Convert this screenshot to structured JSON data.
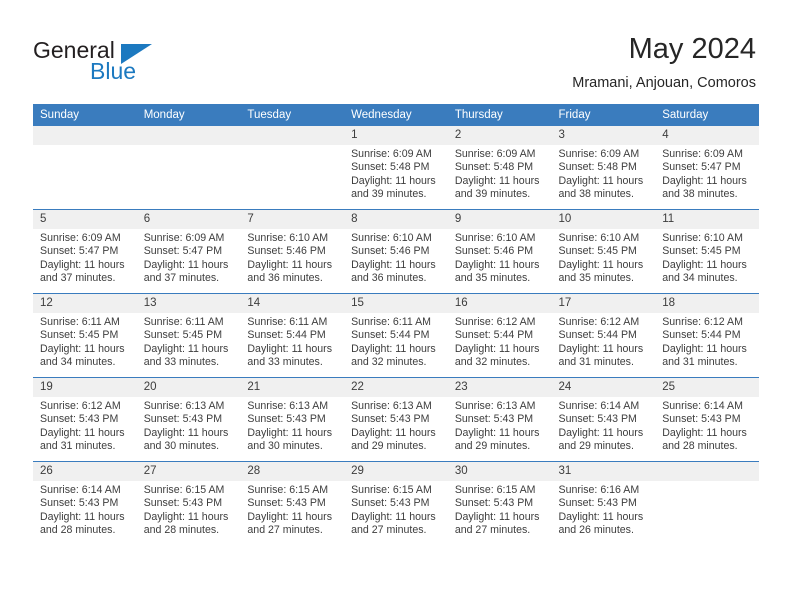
{
  "brand": {
    "name_line1": "General",
    "name_line2": "Blue",
    "logo_icon": "triangle-flag-icon",
    "color_primary": "#1c79c0",
    "color_text": "#231f20"
  },
  "header": {
    "title": "May 2024",
    "subtitle": "Mramani, Anjouan, Comoros"
  },
  "theme": {
    "header_row_bg": "#3a7cbe",
    "daynum_bg": "#f0f0f0",
    "text": "#3d3d3d",
    "divider": "#3a7cbe"
  },
  "calendar": {
    "weekday_headers": [
      "Sunday",
      "Monday",
      "Tuesday",
      "Wednesday",
      "Thursday",
      "Friday",
      "Saturday"
    ],
    "weeks": [
      [
        {
          "day": "",
          "empty": true,
          "sunrise": "",
          "sunset": "",
          "daylight_line1": "",
          "daylight_line2": ""
        },
        {
          "day": "",
          "empty": true,
          "sunrise": "",
          "sunset": "",
          "daylight_line1": "",
          "daylight_line2": ""
        },
        {
          "day": "",
          "empty": true,
          "sunrise": "",
          "sunset": "",
          "daylight_line1": "",
          "daylight_line2": ""
        },
        {
          "day": "1",
          "empty": false,
          "sunrise": "Sunrise: 6:09 AM",
          "sunset": "Sunset: 5:48 PM",
          "daylight_line1": "Daylight: 11 hours",
          "daylight_line2": "and 39 minutes."
        },
        {
          "day": "2",
          "empty": false,
          "sunrise": "Sunrise: 6:09 AM",
          "sunset": "Sunset: 5:48 PM",
          "daylight_line1": "Daylight: 11 hours",
          "daylight_line2": "and 39 minutes."
        },
        {
          "day": "3",
          "empty": false,
          "sunrise": "Sunrise: 6:09 AM",
          "sunset": "Sunset: 5:48 PM",
          "daylight_line1": "Daylight: 11 hours",
          "daylight_line2": "and 38 minutes."
        },
        {
          "day": "4",
          "empty": false,
          "sunrise": "Sunrise: 6:09 AM",
          "sunset": "Sunset: 5:47 PM",
          "daylight_line1": "Daylight: 11 hours",
          "daylight_line2": "and 38 minutes."
        }
      ],
      [
        {
          "day": "5",
          "empty": false,
          "sunrise": "Sunrise: 6:09 AM",
          "sunset": "Sunset: 5:47 PM",
          "daylight_line1": "Daylight: 11 hours",
          "daylight_line2": "and 37 minutes."
        },
        {
          "day": "6",
          "empty": false,
          "sunrise": "Sunrise: 6:09 AM",
          "sunset": "Sunset: 5:47 PM",
          "daylight_line1": "Daylight: 11 hours",
          "daylight_line2": "and 37 minutes."
        },
        {
          "day": "7",
          "empty": false,
          "sunrise": "Sunrise: 6:10 AM",
          "sunset": "Sunset: 5:46 PM",
          "daylight_line1": "Daylight: 11 hours",
          "daylight_line2": "and 36 minutes."
        },
        {
          "day": "8",
          "empty": false,
          "sunrise": "Sunrise: 6:10 AM",
          "sunset": "Sunset: 5:46 PM",
          "daylight_line1": "Daylight: 11 hours",
          "daylight_line2": "and 36 minutes."
        },
        {
          "day": "9",
          "empty": false,
          "sunrise": "Sunrise: 6:10 AM",
          "sunset": "Sunset: 5:46 PM",
          "daylight_line1": "Daylight: 11 hours",
          "daylight_line2": "and 35 minutes."
        },
        {
          "day": "10",
          "empty": false,
          "sunrise": "Sunrise: 6:10 AM",
          "sunset": "Sunset: 5:45 PM",
          "daylight_line1": "Daylight: 11 hours",
          "daylight_line2": "and 35 minutes."
        },
        {
          "day": "11",
          "empty": false,
          "sunrise": "Sunrise: 6:10 AM",
          "sunset": "Sunset: 5:45 PM",
          "daylight_line1": "Daylight: 11 hours",
          "daylight_line2": "and 34 minutes."
        }
      ],
      [
        {
          "day": "12",
          "empty": false,
          "sunrise": "Sunrise: 6:11 AM",
          "sunset": "Sunset: 5:45 PM",
          "daylight_line1": "Daylight: 11 hours",
          "daylight_line2": "and 34 minutes."
        },
        {
          "day": "13",
          "empty": false,
          "sunrise": "Sunrise: 6:11 AM",
          "sunset": "Sunset: 5:45 PM",
          "daylight_line1": "Daylight: 11 hours",
          "daylight_line2": "and 33 minutes."
        },
        {
          "day": "14",
          "empty": false,
          "sunrise": "Sunrise: 6:11 AM",
          "sunset": "Sunset: 5:44 PM",
          "daylight_line1": "Daylight: 11 hours",
          "daylight_line2": "and 33 minutes."
        },
        {
          "day": "15",
          "empty": false,
          "sunrise": "Sunrise: 6:11 AM",
          "sunset": "Sunset: 5:44 PM",
          "daylight_line1": "Daylight: 11 hours",
          "daylight_line2": "and 32 minutes."
        },
        {
          "day": "16",
          "empty": false,
          "sunrise": "Sunrise: 6:12 AM",
          "sunset": "Sunset: 5:44 PM",
          "daylight_line1": "Daylight: 11 hours",
          "daylight_line2": "and 32 minutes."
        },
        {
          "day": "17",
          "empty": false,
          "sunrise": "Sunrise: 6:12 AM",
          "sunset": "Sunset: 5:44 PM",
          "daylight_line1": "Daylight: 11 hours",
          "daylight_line2": "and 31 minutes."
        },
        {
          "day": "18",
          "empty": false,
          "sunrise": "Sunrise: 6:12 AM",
          "sunset": "Sunset: 5:44 PM",
          "daylight_line1": "Daylight: 11 hours",
          "daylight_line2": "and 31 minutes."
        }
      ],
      [
        {
          "day": "19",
          "empty": false,
          "sunrise": "Sunrise: 6:12 AM",
          "sunset": "Sunset: 5:43 PM",
          "daylight_line1": "Daylight: 11 hours",
          "daylight_line2": "and 31 minutes."
        },
        {
          "day": "20",
          "empty": false,
          "sunrise": "Sunrise: 6:13 AM",
          "sunset": "Sunset: 5:43 PM",
          "daylight_line1": "Daylight: 11 hours",
          "daylight_line2": "and 30 minutes."
        },
        {
          "day": "21",
          "empty": false,
          "sunrise": "Sunrise: 6:13 AM",
          "sunset": "Sunset: 5:43 PM",
          "daylight_line1": "Daylight: 11 hours",
          "daylight_line2": "and 30 minutes."
        },
        {
          "day": "22",
          "empty": false,
          "sunrise": "Sunrise: 6:13 AM",
          "sunset": "Sunset: 5:43 PM",
          "daylight_line1": "Daylight: 11 hours",
          "daylight_line2": "and 29 minutes."
        },
        {
          "day": "23",
          "empty": false,
          "sunrise": "Sunrise: 6:13 AM",
          "sunset": "Sunset: 5:43 PM",
          "daylight_line1": "Daylight: 11 hours",
          "daylight_line2": "and 29 minutes."
        },
        {
          "day": "24",
          "empty": false,
          "sunrise": "Sunrise: 6:14 AM",
          "sunset": "Sunset: 5:43 PM",
          "daylight_line1": "Daylight: 11 hours",
          "daylight_line2": "and 29 minutes."
        },
        {
          "day": "25",
          "empty": false,
          "sunrise": "Sunrise: 6:14 AM",
          "sunset": "Sunset: 5:43 PM",
          "daylight_line1": "Daylight: 11 hours",
          "daylight_line2": "and 28 minutes."
        }
      ],
      [
        {
          "day": "26",
          "empty": false,
          "sunrise": "Sunrise: 6:14 AM",
          "sunset": "Sunset: 5:43 PM",
          "daylight_line1": "Daylight: 11 hours",
          "daylight_line2": "and 28 minutes."
        },
        {
          "day": "27",
          "empty": false,
          "sunrise": "Sunrise: 6:15 AM",
          "sunset": "Sunset: 5:43 PM",
          "daylight_line1": "Daylight: 11 hours",
          "daylight_line2": "and 28 minutes."
        },
        {
          "day": "28",
          "empty": false,
          "sunrise": "Sunrise: 6:15 AM",
          "sunset": "Sunset: 5:43 PM",
          "daylight_line1": "Daylight: 11 hours",
          "daylight_line2": "and 27 minutes."
        },
        {
          "day": "29",
          "empty": false,
          "sunrise": "Sunrise: 6:15 AM",
          "sunset": "Sunset: 5:43 PM",
          "daylight_line1": "Daylight: 11 hours",
          "daylight_line2": "and 27 minutes."
        },
        {
          "day": "30",
          "empty": false,
          "sunrise": "Sunrise: 6:15 AM",
          "sunset": "Sunset: 5:43 PM",
          "daylight_line1": "Daylight: 11 hours",
          "daylight_line2": "and 27 minutes."
        },
        {
          "day": "31",
          "empty": false,
          "sunrise": "Sunrise: 6:16 AM",
          "sunset": "Sunset: 5:43 PM",
          "daylight_line1": "Daylight: 11 hours",
          "daylight_line2": "and 26 minutes."
        },
        {
          "day": "",
          "empty": true,
          "sunrise": "",
          "sunset": "",
          "daylight_line1": "",
          "daylight_line2": ""
        }
      ]
    ]
  }
}
